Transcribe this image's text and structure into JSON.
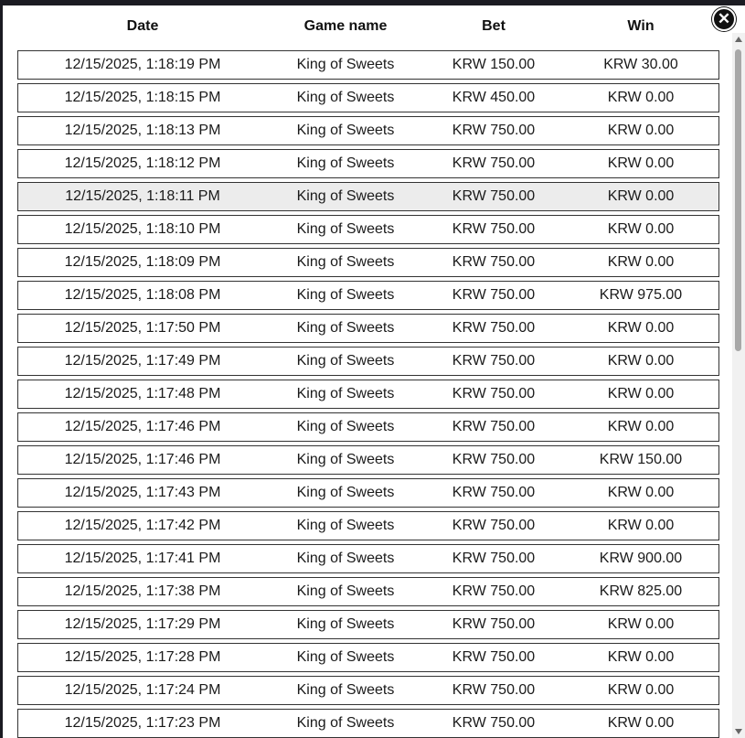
{
  "table": {
    "headers": {
      "date": "Date",
      "game": "Game name",
      "bet": "Bet",
      "win": "Win"
    },
    "rows": [
      {
        "date": "12/15/2025, 1:18:19 PM",
        "game": "King of Sweets",
        "bet": "KRW 150.00",
        "win": "KRW 30.00"
      },
      {
        "date": "12/15/2025, 1:18:15 PM",
        "game": "King of Sweets",
        "bet": "KRW 450.00",
        "win": "KRW 0.00"
      },
      {
        "date": "12/15/2025, 1:18:13 PM",
        "game": "King of Sweets",
        "bet": "KRW 750.00",
        "win": "KRW 0.00"
      },
      {
        "date": "12/15/2025, 1:18:12 PM",
        "game": "King of Sweets",
        "bet": "KRW 750.00",
        "win": "KRW 0.00"
      },
      {
        "date": "12/15/2025, 1:18:11 PM",
        "game": "King of Sweets",
        "bet": "KRW 750.00",
        "win": "KRW 0.00"
      },
      {
        "date": "12/15/2025, 1:18:10 PM",
        "game": "King of Sweets",
        "bet": "KRW 750.00",
        "win": "KRW 0.00"
      },
      {
        "date": "12/15/2025, 1:18:09 PM",
        "game": "King of Sweets",
        "bet": "KRW 750.00",
        "win": "KRW 0.00"
      },
      {
        "date": "12/15/2025, 1:18:08 PM",
        "game": "King of Sweets",
        "bet": "KRW 750.00",
        "win": "KRW 975.00"
      },
      {
        "date": "12/15/2025, 1:17:50 PM",
        "game": "King of Sweets",
        "bet": "KRW 750.00",
        "win": "KRW 0.00"
      },
      {
        "date": "12/15/2025, 1:17:49 PM",
        "game": "King of Sweets",
        "bet": "KRW 750.00",
        "win": "KRW 0.00"
      },
      {
        "date": "12/15/2025, 1:17:48 PM",
        "game": "King of Sweets",
        "bet": "KRW 750.00",
        "win": "KRW 0.00"
      },
      {
        "date": "12/15/2025, 1:17:46 PM",
        "game": "King of Sweets",
        "bet": "KRW 750.00",
        "win": "KRW 0.00"
      },
      {
        "date": "12/15/2025, 1:17:46 PM",
        "game": "King of Sweets",
        "bet": "KRW 750.00",
        "win": "KRW 150.00"
      },
      {
        "date": "12/15/2025, 1:17:43 PM",
        "game": "King of Sweets",
        "bet": "KRW 750.00",
        "win": "KRW 0.00"
      },
      {
        "date": "12/15/2025, 1:17:42 PM",
        "game": "King of Sweets",
        "bet": "KRW 750.00",
        "win": "KRW 0.00"
      },
      {
        "date": "12/15/2025, 1:17:41 PM",
        "game": "King of Sweets",
        "bet": "KRW 750.00",
        "win": "KRW 900.00"
      },
      {
        "date": "12/15/2025, 1:17:38 PM",
        "game": "King of Sweets",
        "bet": "KRW 750.00",
        "win": "KRW 825.00"
      },
      {
        "date": "12/15/2025, 1:17:29 PM",
        "game": "King of Sweets",
        "bet": "KRW 750.00",
        "win": "KRW 0.00"
      },
      {
        "date": "12/15/2025, 1:17:28 PM",
        "game": "King of Sweets",
        "bet": "KRW 750.00",
        "win": "KRW 0.00"
      },
      {
        "date": "12/15/2025, 1:17:24 PM",
        "game": "King of Sweets",
        "bet": "KRW 750.00",
        "win": "KRW 0.00"
      },
      {
        "date": "12/15/2025, 1:17:23 PM",
        "game": "King of Sweets",
        "bet": "KRW 750.00",
        "win": "KRW 0.00"
      }
    ]
  },
  "close_button": {
    "icon": "close-icon",
    "glyph": "✕"
  },
  "colors": {
    "row_highlight": "#ececec",
    "row_border": "#333333",
    "close_bg": "#111111"
  }
}
